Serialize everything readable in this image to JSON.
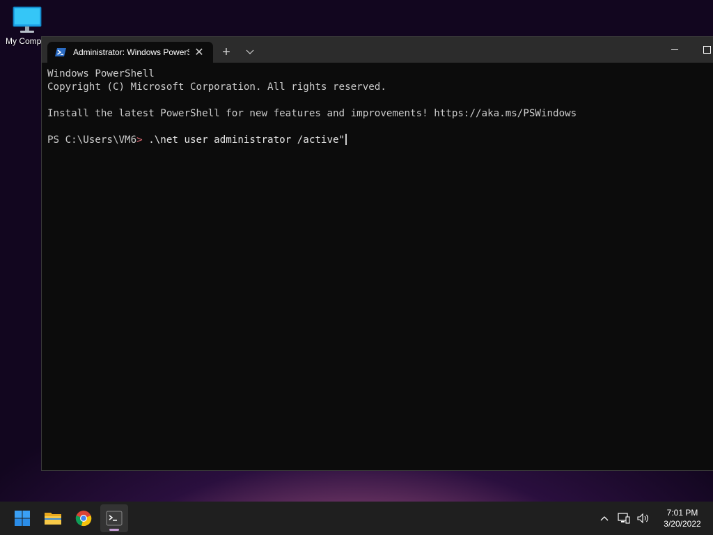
{
  "desktop": {
    "icons": [
      {
        "label": "My Computer",
        "icon": "monitor-icon"
      }
    ]
  },
  "terminal": {
    "tab_title": "Administrator: Windows PowerShell",
    "tab_icon": "powershell-icon",
    "new_tab_symbol": "+",
    "dropdown_symbol": "⌵",
    "close_symbol": "✕",
    "lines": [
      "Windows PowerShell",
      "Copyright (C) Microsoft Corporation. All rights reserved.",
      "",
      "Install the latest PowerShell for new features and improvements! https://aka.ms/PSWindows",
      ""
    ],
    "prompt": {
      "path": "PS C:\\Users\\VM6",
      "symbol": ">",
      "command": " .\\net user administrator /active\""
    }
  },
  "taskbar": {
    "apps": [
      {
        "name": "Start",
        "icon": "windows-start-icon"
      },
      {
        "name": "File Explorer",
        "icon": "folder-icon"
      },
      {
        "name": "Google Chrome",
        "icon": "chrome-icon"
      },
      {
        "name": "Terminal",
        "icon": "terminal-icon",
        "active": true
      }
    ],
    "tray": {
      "icons": [
        "chevron-up-icon",
        "network-icon",
        "volume-icon"
      ],
      "time": "7:01 PM",
      "date": "3/20/2022"
    }
  },
  "colors": {
    "terminal_bg": "#0c0c0c",
    "titlebar_bg": "#2c2c2c",
    "prompt_symbol": "#e06c75",
    "taskbar_bg": "#1f1f1f"
  }
}
